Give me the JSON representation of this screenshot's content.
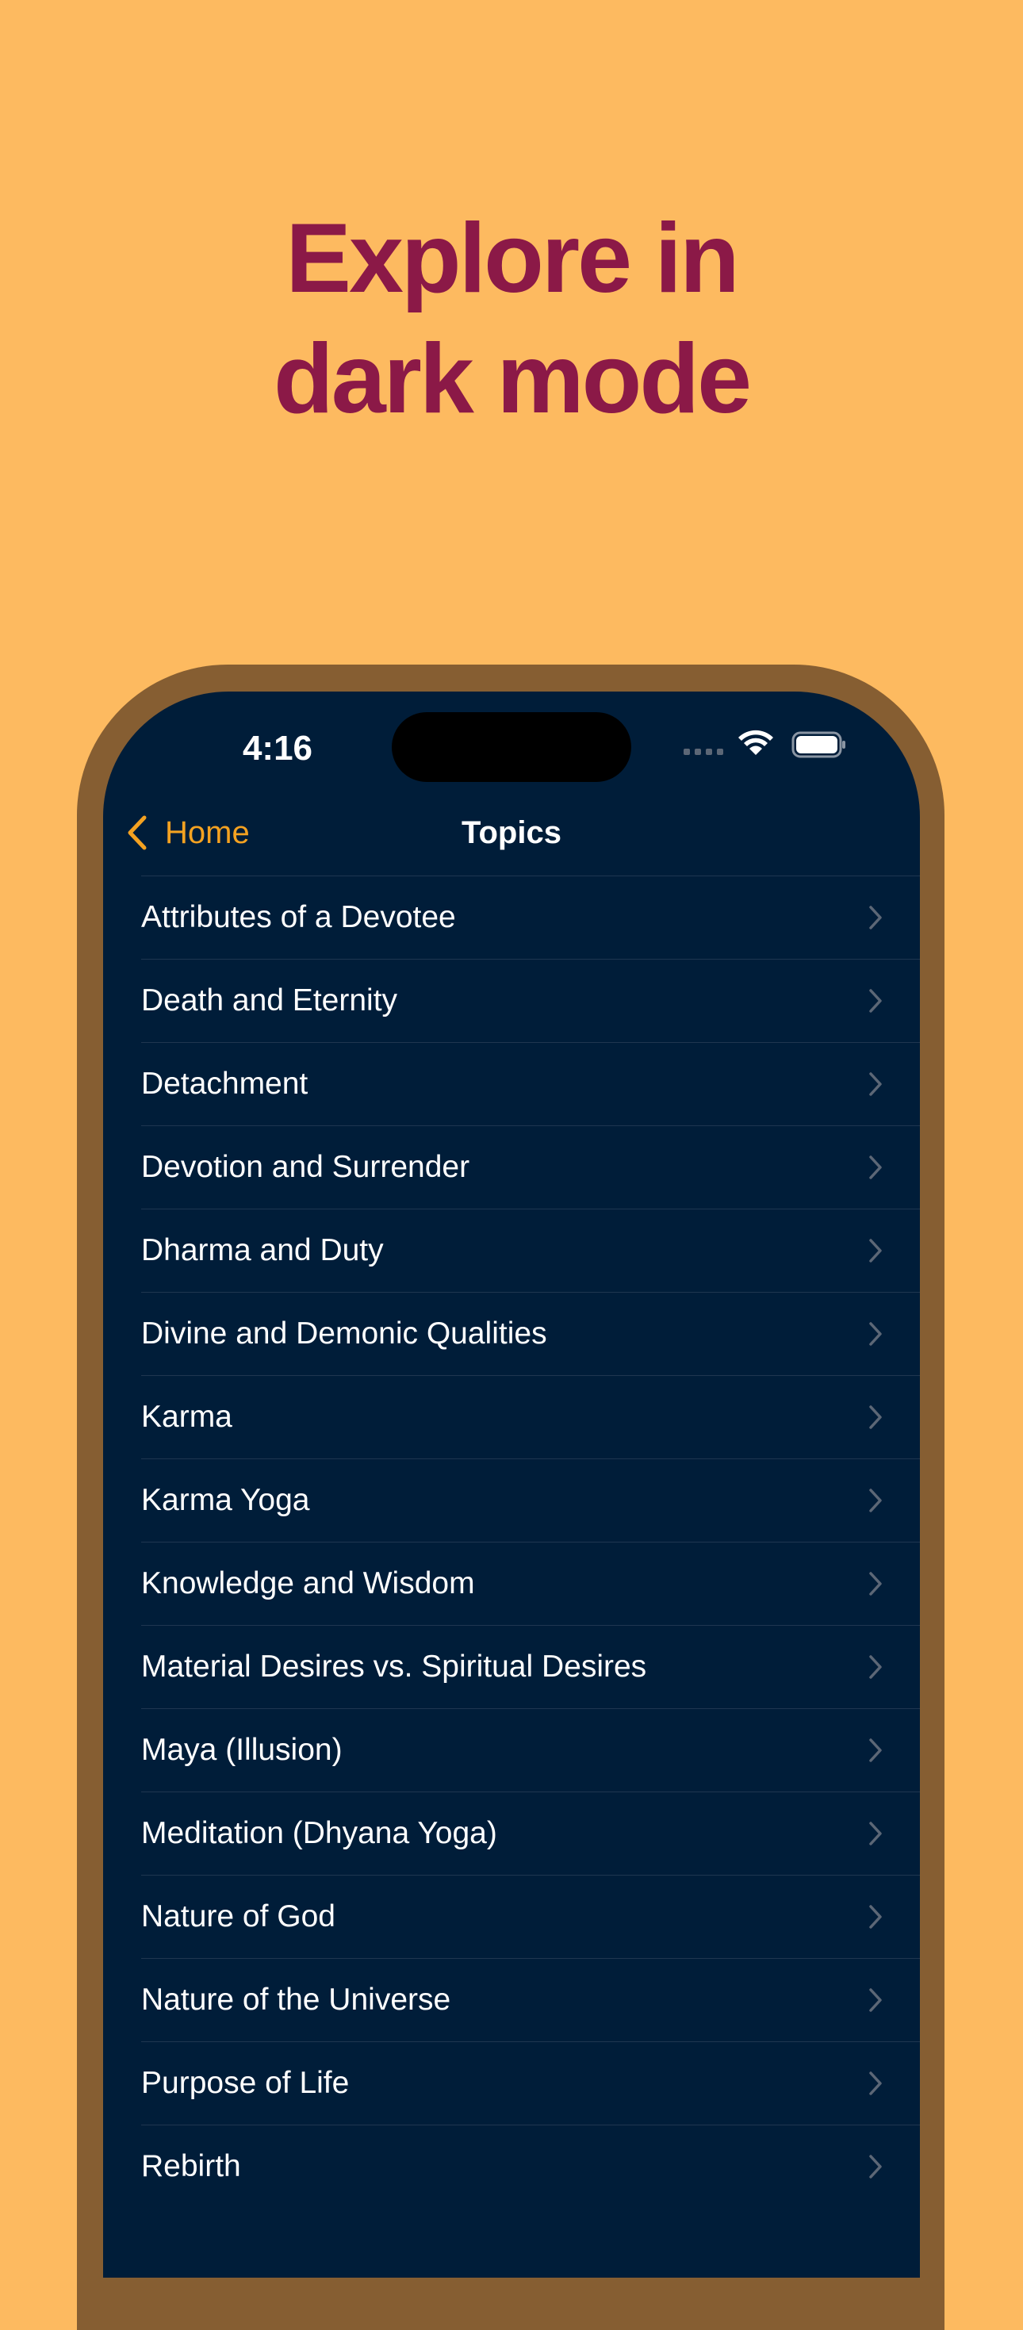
{
  "headline": {
    "line1": "Explore in",
    "line2": "dark mode"
  },
  "status_bar": {
    "time": "4:16"
  },
  "nav": {
    "back_label": "Home",
    "title": "Topics"
  },
  "topics": [
    "Attributes of a Devotee",
    "Death and Eternity",
    "Detachment",
    "Devotion and Surrender",
    "Dharma and Duty",
    "Divine and Demonic Qualities",
    "Karma",
    "Karma Yoga",
    "Knowledge and Wisdom",
    "Material Desires vs. Spiritual Desires",
    "Maya (Illusion)",
    "Meditation (Dhyana Yoga)",
    "Nature of God",
    "Nature of the Universe",
    "Purpose of Life",
    "Rebirth"
  ],
  "colors": {
    "background": "#FDBA60",
    "headline": "#8B1947",
    "phone_frame": "#865E32",
    "screen": "#001D39",
    "accent": "#F4A221",
    "text": "#FFFFFF",
    "separator": "#1F3650",
    "chevron": "#5C6776"
  },
  "icons": {
    "back": "chevron-left-icon",
    "row": "chevron-right-icon",
    "wifi": "wifi-icon",
    "battery": "battery-icon",
    "signal": "cellular-signal-icon"
  }
}
